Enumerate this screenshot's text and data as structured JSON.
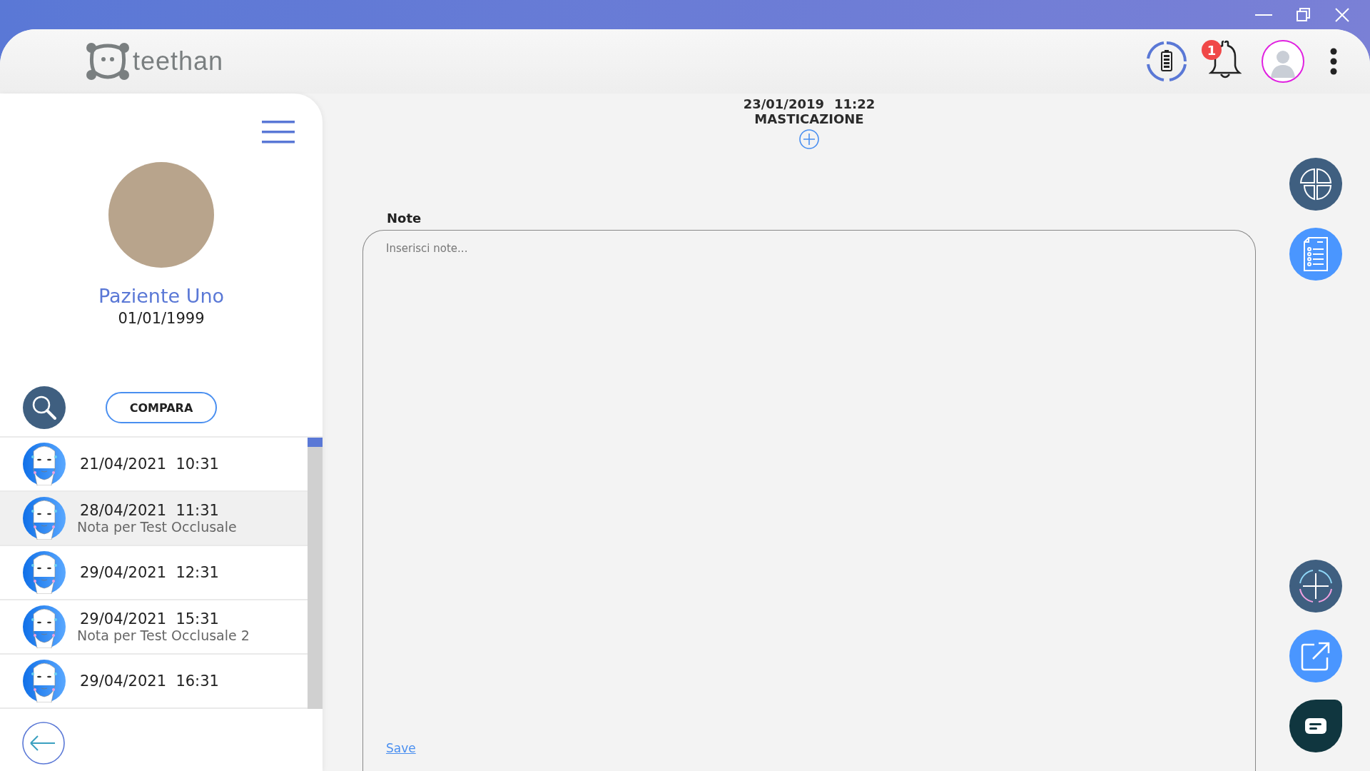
{
  "header": {
    "logo_text": "teethan",
    "notification_count": "1"
  },
  "patient": {
    "name": "Paziente Uno",
    "birth_date": "01/01/1999"
  },
  "compare_button": "COMPARA",
  "sessions": [
    {
      "date_time": "21/04/2021  10:31",
      "selected": false
    },
    {
      "date_time": "28/04/2021  11:31",
      "note": "Nota per Test Occlusale",
      "selected": true
    },
    {
      "date_time": "29/04/2021  12:31",
      "selected": false
    },
    {
      "date_time": "29/04/2021  15:31",
      "note": "Nota per Test Occlusale 2",
      "selected": false
    },
    {
      "date_time": "29/04/2021  16:31",
      "selected": false
    }
  ],
  "record": {
    "date": "23/01/2019",
    "time": "11:22",
    "title": "MASTICAZIONE"
  },
  "notes": {
    "label": "Note",
    "placeholder": "Inserisci note...",
    "save_link": "Save"
  }
}
